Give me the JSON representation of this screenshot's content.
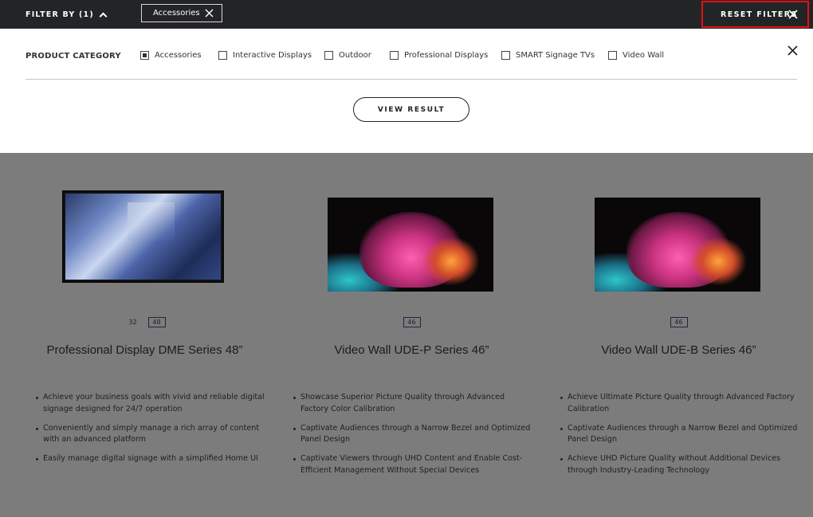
{
  "filter_bar": {
    "filter_by_label": "FILTER BY (1)",
    "active_chip": "Accessories",
    "reset_label": "RESET FILTERS"
  },
  "panel": {
    "category_label": "PRODUCT CATEGORY",
    "options": [
      {
        "label": "Accessories",
        "checked": true
      },
      {
        "label": "Interactive Displays",
        "checked": false
      },
      {
        "label": "Outdoor",
        "checked": false
      },
      {
        "label": "Professional Displays",
        "checked": false
      },
      {
        "label": "SMART Signage TVs",
        "checked": false
      },
      {
        "label": "Video Wall",
        "checked": false
      }
    ],
    "view_result_label": "VIEW RESULT"
  },
  "products": [
    {
      "title": "Professional Display DME Series 48”",
      "sizes": [
        {
          "label": "32",
          "selected": false
        },
        {
          "label": "48",
          "selected": true
        }
      ],
      "features": [
        "Achieve your business goals with vivid and reliable digital signage designed for 24/7 operation",
        "Conveniently and simply manage a rich array of content with an advanced platform",
        "Easily manage digital signage with a simplified Home UI"
      ]
    },
    {
      "title": "Video Wall UDE-P Series 46”",
      "sizes": [
        {
          "label": "46",
          "selected": true
        }
      ],
      "features": [
        "Showcase Superior Picture Quality through Advanced Factory Color Calibration",
        "Captivate Audiences through a Narrow Bezel and Optimized Panel Design",
        "Captivate Viewers through UHD Content and Enable Cost-Efficient Management Without Special Devices"
      ]
    },
    {
      "title": "Video Wall UDE-B Series 46”",
      "sizes": [
        {
          "label": "46",
          "selected": true
        }
      ],
      "features": [
        "Achieve Ultimate Picture Quality through Advanced Factory Calibration",
        "Captivate Audiences through a Narrow Bezel and Optimized Panel Design",
        "Achieve UHD Picture Quality without Additional Devices through Industry-Leading Technology"
      ]
    }
  ],
  "colors": {
    "topbar": "#232426",
    "overlay": "#7c7c7c",
    "reset_highlight": "#e0121a"
  },
  "icons": [
    "chevron-up-icon",
    "close-icon",
    "checkbox-icon"
  ]
}
